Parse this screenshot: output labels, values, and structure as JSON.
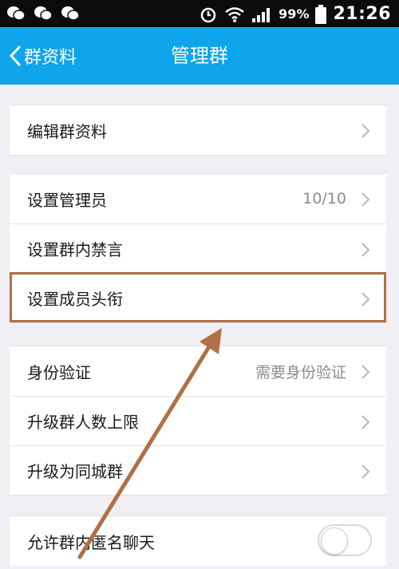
{
  "status_bar": {
    "notification_icons": [
      "wechat-icon",
      "wechat-icon",
      "wechat-icon"
    ],
    "battery_percent": "99%",
    "time": "21:26"
  },
  "header": {
    "back_label": "群资料",
    "title": "管理群"
  },
  "groups": [
    {
      "items": [
        {
          "label": "编辑群资料"
        }
      ]
    },
    {
      "items": [
        {
          "label": "设置管理员",
          "value": "10/10"
        },
        {
          "label": "设置群内禁言"
        },
        {
          "label": "设置成员头衔",
          "highlighted": true
        }
      ]
    },
    {
      "items": [
        {
          "label": "身份验证",
          "value": "需要身份验证"
        },
        {
          "label": "升级群人数上限"
        },
        {
          "label": "升级为同城群"
        }
      ]
    },
    {
      "items": [
        {
          "label": "允许群内匿名聊天",
          "toggle": false
        }
      ]
    }
  ],
  "colors": {
    "header_bg": "#0ea5eb",
    "annotation": "#b06f45"
  }
}
